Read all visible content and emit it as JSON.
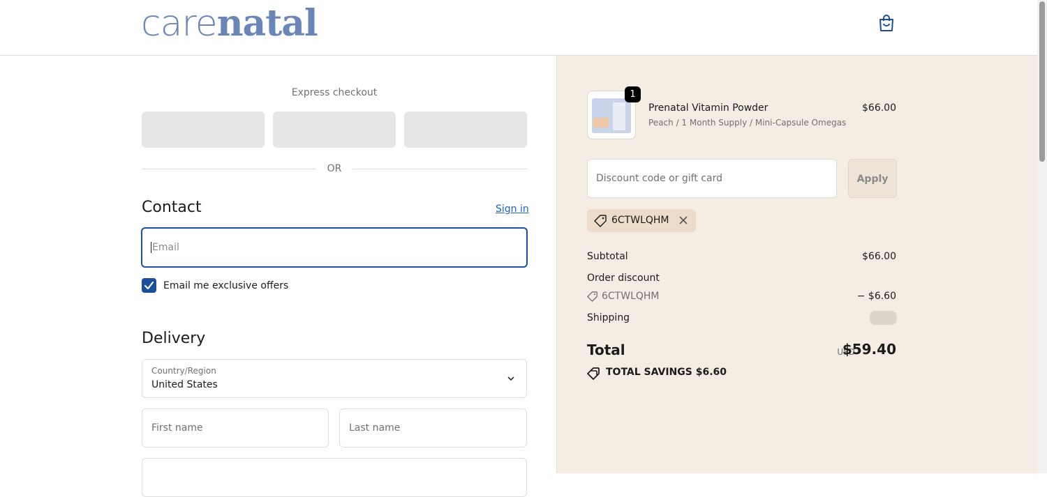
{
  "header": {
    "logo_light": "care",
    "logo_bold": "natal",
    "colors": {
      "brand": "#6a86b7",
      "accent": "#1b4f9c"
    }
  },
  "express": {
    "title": "Express checkout",
    "or_text": "OR"
  },
  "contact": {
    "title": "Contact",
    "sign_in": "Sign in",
    "email_placeholder": "Email",
    "offers_label": "Email me exclusive offers",
    "offers_checked": true
  },
  "delivery": {
    "title": "Delivery",
    "country_label": "Country/Region",
    "country_value": "United States",
    "first_name_placeholder": "First name",
    "last_name_placeholder": "Last name"
  },
  "summary": {
    "product": {
      "quantity": "1",
      "name": "Prenatal Vitamin Powder",
      "variant": "Peach / 1 Month Supply / Mini-Capsule Omegas",
      "price": "$66.00"
    },
    "discount_placeholder": "Discount code or gift card",
    "apply_label": "Apply",
    "applied_code": "6CTWLQHM",
    "subtotal_label": "Subtotal",
    "subtotal_value": "$66.00",
    "order_discount_label": "Order discount",
    "discount_code": "6CTWLQHM",
    "discount_value": "− $6.60",
    "shipping_label": "Shipping",
    "total_label": "Total",
    "currency": "USD",
    "total_value": "$59.40",
    "savings_label": "TOTAL SAVINGS",
    "savings_value": "$6.60"
  }
}
